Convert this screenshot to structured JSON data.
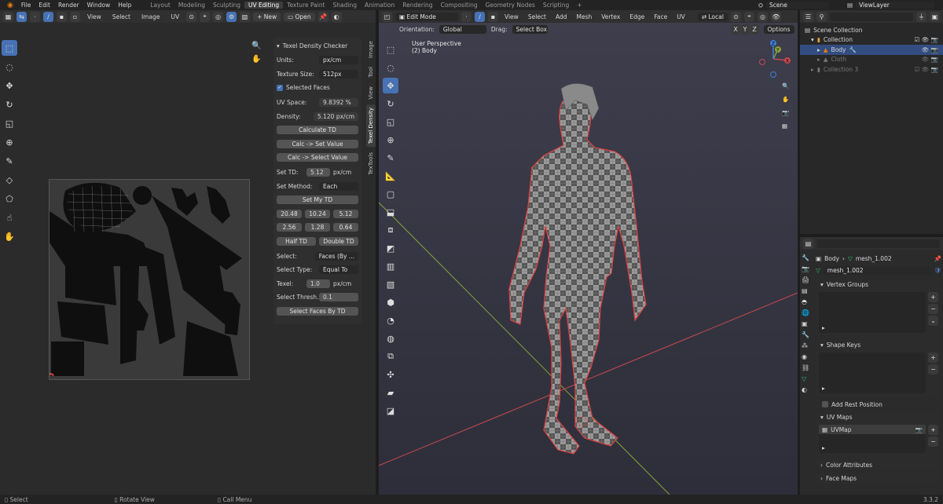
{
  "menubar": {
    "items": [
      "File",
      "Edit",
      "Render",
      "Window",
      "Help"
    ],
    "workspaces": [
      "Layout",
      "Modeling",
      "Sculpting",
      "UV Editing",
      "Texture Paint",
      "Shading",
      "Animation",
      "Rendering",
      "Compositing",
      "Geometry Nodes",
      "Scripting"
    ],
    "active_workspace_index": 3,
    "add_tab": "+",
    "scene": "Scene",
    "view_layer": "ViewLayer"
  },
  "uv_editor": {
    "header_menus": [
      "View",
      "Select",
      "Image",
      "UV"
    ],
    "new_label": "New",
    "open_label": "Open",
    "side_tabs": [
      "Image",
      "Tool",
      "View",
      "Texel Density",
      "TexTools"
    ],
    "active_tab_index": 3
  },
  "texel_panel": {
    "title": "Texel Density Checker",
    "units_label": "Units:",
    "units_value": "px/cm",
    "texture_size_label": "Texture Size:",
    "texture_size_value": "512px",
    "selected_faces_label": "Selected Faces",
    "selected_faces_checked": true,
    "uv_space_label": "UV Space:",
    "uv_space_value": "9.8392 %",
    "density_label": "Density:",
    "density_value": "5.120 px/cm",
    "calculate_td": "Calculate TD",
    "calc_set_value": "Calc -> Set Value",
    "calc_select_value": "Calc -> Select Value",
    "set_td_label": "Set TD:",
    "set_td_value": "5.12",
    "set_td_unit": "px/cm",
    "set_method_label": "Set Method:",
    "set_method_value": "Each",
    "set_my_td": "Set My TD",
    "presets_row1": [
      "20.48",
      "10.24",
      "5.12"
    ],
    "presets_row2": [
      "2.56",
      "1.28",
      "0.64"
    ],
    "half_td": "Half TD",
    "double_td": "Double TD",
    "select_label": "Select:",
    "select_value": "Faces (By ...",
    "select_type_label": "Select Type:",
    "select_type_value": "Equal To",
    "texel_label": "Texel:",
    "texel_value": "1.0",
    "texel_unit": "px/cm",
    "select_thresh_label": "Select Thresh...",
    "select_thresh_value": "0.1",
    "select_faces_by_td": "Select Faces By TD"
  },
  "viewport": {
    "mode": "Edit Mode",
    "header_menus": [
      "View",
      "Select",
      "Add",
      "Mesh",
      "Vertex",
      "Edge",
      "Face",
      "UV"
    ],
    "transform_orientation": "Local",
    "orientation_label": "Orientation:",
    "orientation_value": "Global",
    "drag_label": "Drag:",
    "drag_value": "Select Box",
    "axes": [
      "X",
      "Y",
      "Z"
    ],
    "options_label": "Options",
    "overlay_line1": "User Perspective",
    "overlay_line2": "(2) Body",
    "gizmo_x": "X",
    "gizmo_y": "Y",
    "gizmo_z": "Z"
  },
  "outliner": {
    "rows": [
      {
        "label": "Scene Collection",
        "indent": 0,
        "dim": false,
        "selected": false
      },
      {
        "label": "Collection",
        "indent": 1,
        "dim": false,
        "selected": false
      },
      {
        "label": "Body",
        "indent": 2,
        "dim": false,
        "selected": true
      },
      {
        "label": "Cloth",
        "indent": 2,
        "dim": true,
        "selected": false
      },
      {
        "label": "Collection 3",
        "indent": 1,
        "dim": true,
        "selected": false
      }
    ]
  },
  "properties": {
    "object_name": "Body",
    "mesh_name": "mesh_1.002",
    "mesh_field": "mesh_1.002",
    "vertex_groups": "Vertex Groups",
    "shape_keys": "Shape Keys",
    "add_rest_position": "Add Rest Position",
    "uv_maps": "UV Maps",
    "uvmap_item": "UVMap",
    "color_attributes": "Color Attributes",
    "face_maps": "Face Maps"
  },
  "statusbar": {
    "items": [
      "Select",
      "Rotate View",
      "Call Menu"
    ],
    "version": "3.3.2"
  },
  "colors": {
    "accent": "#4772b3",
    "seam": "#e04040",
    "x_axis": "#c84a4a",
    "y_axis": "#87a13a"
  }
}
